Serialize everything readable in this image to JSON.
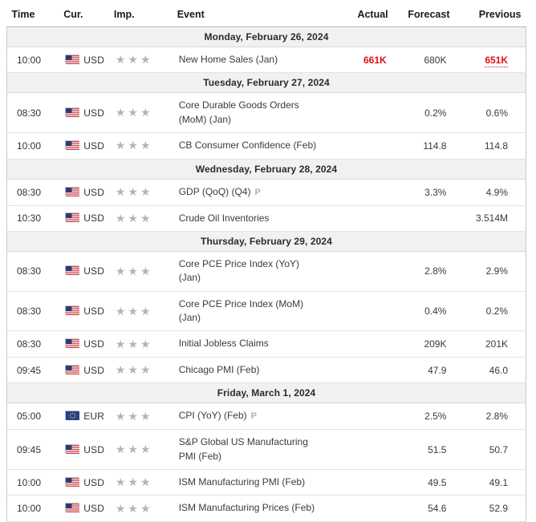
{
  "table": {
    "columns": [
      {
        "key": "time",
        "label": "Time"
      },
      {
        "key": "cur",
        "label": "Cur."
      },
      {
        "key": "imp",
        "label": "Imp."
      },
      {
        "key": "event",
        "label": "Event"
      },
      {
        "key": "actual",
        "label": "Actual"
      },
      {
        "key": "forecast",
        "label": "Forecast"
      },
      {
        "key": "previous",
        "label": "Previous"
      }
    ],
    "groups": [
      {
        "date": "Monday, February 26, 2024",
        "rows": [
          {
            "time": "10:00",
            "currency": "USD",
            "flag": "us-flag-icon",
            "importance": 3,
            "event_lines": [
              "New Home Sales (Jan)"
            ],
            "revised_marker": "",
            "actual": "661K",
            "actual_style": "red",
            "forecast": "680K",
            "previous": "651K",
            "previous_style": "red-underline"
          }
        ]
      },
      {
        "date": "Tuesday, February 27, 2024",
        "rows": [
          {
            "time": "08:30",
            "currency": "USD",
            "flag": "us-flag-icon",
            "importance": 3,
            "event_lines": [
              "Core Durable Goods Orders",
              "(MoM) (Jan)"
            ],
            "revised_marker": "",
            "actual": "",
            "actual_style": "plain",
            "forecast": "0.2%",
            "previous": "0.6%",
            "previous_style": "plain"
          },
          {
            "time": "10:00",
            "currency": "USD",
            "flag": "us-flag-icon",
            "importance": 3,
            "event_lines": [
              "CB Consumer Confidence (Feb)"
            ],
            "revised_marker": "",
            "actual": "",
            "actual_style": "plain",
            "forecast": "114.8",
            "previous": "114.8",
            "previous_style": "plain"
          }
        ]
      },
      {
        "date": "Wednesday, February 28, 2024",
        "rows": [
          {
            "time": "08:30",
            "currency": "USD",
            "flag": "us-flag-icon",
            "importance": 3,
            "event_lines": [
              "GDP (QoQ) (Q4)"
            ],
            "revised_marker": "P",
            "actual": "",
            "actual_style": "plain",
            "forecast": "3.3%",
            "previous": "4.9%",
            "previous_style": "plain"
          },
          {
            "time": "10:30",
            "currency": "USD",
            "flag": "us-flag-icon",
            "importance": 3,
            "event_lines": [
              "Crude Oil Inventories"
            ],
            "revised_marker": "",
            "actual": "",
            "actual_style": "plain",
            "forecast": "",
            "previous": "3.514M",
            "previous_style": "plain"
          }
        ]
      },
      {
        "date": "Thursday, February 29, 2024",
        "rows": [
          {
            "time": "08:30",
            "currency": "USD",
            "flag": "us-flag-icon",
            "importance": 3,
            "event_lines": [
              "Core PCE Price Index (YoY)",
              "(Jan)"
            ],
            "revised_marker": "",
            "actual": "",
            "actual_style": "plain",
            "forecast": "2.8%",
            "previous": "2.9%",
            "previous_style": "plain"
          },
          {
            "time": "08:30",
            "currency": "USD",
            "flag": "us-flag-icon",
            "importance": 3,
            "event_lines": [
              "Core PCE Price Index (MoM)",
              "(Jan)"
            ],
            "revised_marker": "",
            "actual": "",
            "actual_style": "plain",
            "forecast": "0.4%",
            "previous": "0.2%",
            "previous_style": "plain"
          },
          {
            "time": "08:30",
            "currency": "USD",
            "flag": "us-flag-icon",
            "importance": 3,
            "event_lines": [
              "Initial Jobless Claims"
            ],
            "revised_marker": "",
            "actual": "",
            "actual_style": "plain",
            "forecast": "209K",
            "previous": "201K",
            "previous_style": "plain"
          },
          {
            "time": "09:45",
            "currency": "USD",
            "flag": "us-flag-icon",
            "importance": 3,
            "event_lines": [
              "Chicago PMI (Feb)"
            ],
            "revised_marker": "",
            "actual": "",
            "actual_style": "plain",
            "forecast": "47.9",
            "previous": "46.0",
            "previous_style": "plain"
          }
        ]
      },
      {
        "date": "Friday, March 1, 2024",
        "rows": [
          {
            "time": "05:00",
            "currency": "EUR",
            "flag": "eu-flag-icon",
            "importance": 3,
            "event_lines": [
              "CPI (YoY) (Feb)"
            ],
            "revised_marker": "P",
            "actual": "",
            "actual_style": "plain",
            "forecast": "2.5%",
            "previous": "2.8%",
            "previous_style": "plain"
          },
          {
            "time": "09:45",
            "currency": "USD",
            "flag": "us-flag-icon",
            "importance": 3,
            "event_lines": [
              "S&P Global US Manufacturing",
              "PMI (Feb)"
            ],
            "revised_marker": "",
            "actual": "",
            "actual_style": "plain",
            "forecast": "51.5",
            "previous": "50.7",
            "previous_style": "plain"
          },
          {
            "time": "10:00",
            "currency": "USD",
            "flag": "us-flag-icon",
            "importance": 3,
            "event_lines": [
              "ISM Manufacturing PMI (Feb)"
            ],
            "revised_marker": "",
            "actual": "",
            "actual_style": "plain",
            "forecast": "49.5",
            "previous": "49.1",
            "previous_style": "plain"
          },
          {
            "time": "10:00",
            "currency": "USD",
            "flag": "us-flag-icon",
            "importance": 3,
            "event_lines": [
              "ISM Manufacturing Prices (Feb)"
            ],
            "revised_marker": "",
            "actual": "",
            "actual_style": "plain",
            "forecast": "54.6",
            "previous": "52.9",
            "previous_style": "plain"
          }
        ]
      }
    ]
  },
  "icons": {
    "star_glyph": "★",
    "star_color": "#b4b4b4"
  },
  "colors": {
    "value_negative": "#e01010",
    "text_default": "#3a3a3a",
    "date_row_bg": "#f1f1f1",
    "border": "#c9c9c9"
  }
}
